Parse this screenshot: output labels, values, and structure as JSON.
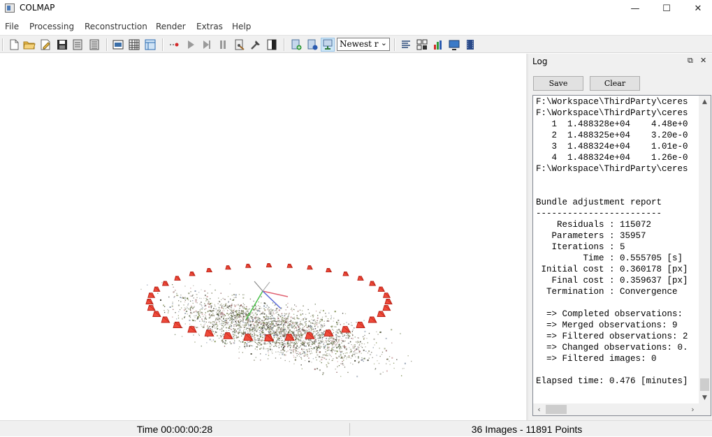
{
  "window": {
    "title": "COLMAP"
  },
  "menu": [
    "File",
    "Processing",
    "Reconstruction",
    "Render",
    "Extras",
    "Help"
  ],
  "toolbar": {
    "icons": [
      "new-project-icon",
      "open-project-icon",
      "edit-project-icon",
      "save-project-icon",
      "import-icon",
      "export-icon",
      "feature-extraction-icon",
      "feature-matching-icon",
      "database-icon",
      "start-reconstruction-icon",
      "play-icon",
      "step-icon",
      "pause-icon",
      "bundle-adjustment-icon",
      "dense-reconstruction-icon",
      "render-icon",
      "reconstruction-stats-icon",
      "match-matrix-icon",
      "show-log-icon"
    ],
    "reconstruction_combo": "Newest r",
    "tail_icons": [
      "render-options-icon",
      "grab-image-icon",
      "chart-icon",
      "display-icon",
      "movie-icon"
    ]
  },
  "log": {
    "title": "Log",
    "save_label": "Save",
    "clear_label": "Clear",
    "lines": [
      "F:\\Workspace\\ThirdParty\\ceres",
      "F:\\Workspace\\ThirdParty\\ceres",
      "   1  1.488328e+04    4.48e+0",
      "   2  1.488325e+04    3.20e-0",
      "   3  1.488324e+04    1.01e-0",
      "   4  1.488324e+04    1.26e-0",
      "F:\\Workspace\\ThirdParty\\ceres",
      "",
      "",
      "Bundle adjustment report",
      "------------------------",
      "    Residuals : 115072",
      "   Parameters : 35957",
      "   Iterations : 5",
      "         Time : 0.555705 [s]",
      " Initial cost : 0.360178 [px]",
      "   Final cost : 0.359637 [px]",
      "  Termination : Convergence",
      "",
      "  => Completed observations:",
      "  => Merged observations: 9",
      "  => Filtered observations: 2",
      "  => Changed observations: 0.",
      "  => Filtered images: 0",
      "",
      "Elapsed time: 0.476 [minutes]"
    ]
  },
  "status": {
    "time": "Time 00:00:00:28",
    "summary": "36 Images - 11891 Points"
  }
}
